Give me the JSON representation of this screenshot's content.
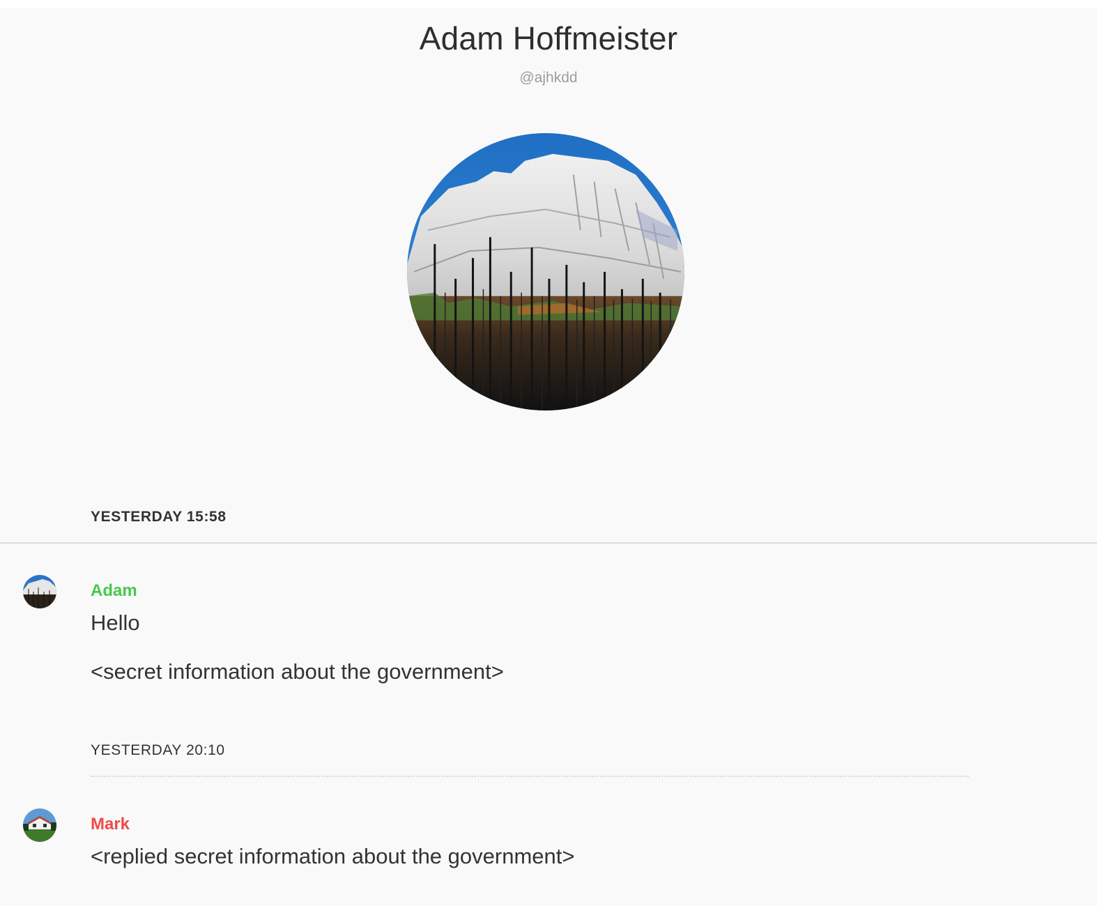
{
  "profile": {
    "name": "Adam Hoffmeister",
    "handle": "@ajhkdd"
  },
  "conversation": {
    "date_header": "YESTERDAY 15:58",
    "groups": [
      {
        "sender": "Adam",
        "sender_color": "#46c84a",
        "messages": [
          "Hello",
          "<secret information about the government>"
        ]
      },
      {
        "separator": "YESTERDAY 20:10",
        "sender": "Mark",
        "sender_color": "#f04a4a",
        "messages": [
          "<replied secret information about the government>"
        ]
      }
    ]
  }
}
